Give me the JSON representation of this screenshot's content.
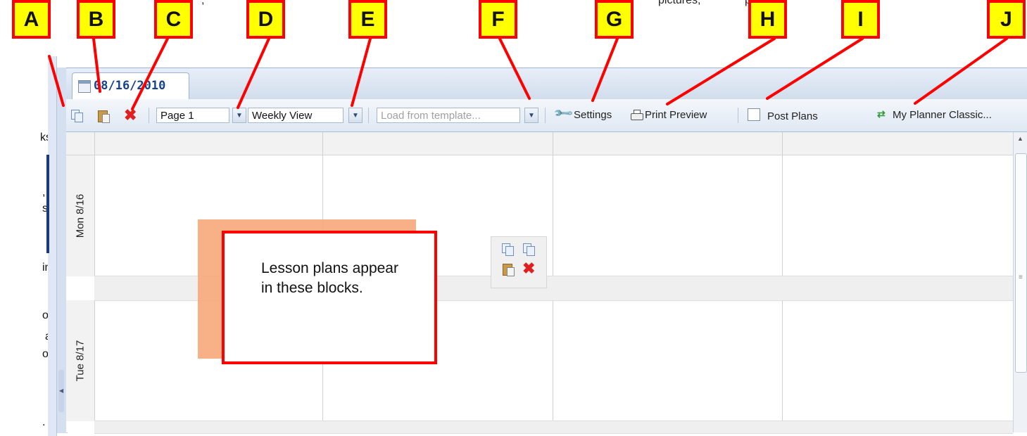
{
  "text_fragments": {
    "top_line": [
      ",",
      "pictures,",
      "page"
    ],
    "left_margin": [
      "ks)",
      ",",
      "s,",
      "in",
      "or",
      "a",
      "or",
      "."
    ]
  },
  "tab": {
    "date": "08/16/2010"
  },
  "toolbar": {
    "page_value": "Page 1",
    "view_value": "Weekly View",
    "template_placeholder": "Load from template...",
    "settings_label": "Settings",
    "print_preview_label": "Print Preview",
    "post_plans_label": "Post Plans",
    "classic_label": "My Planner Classic..."
  },
  "days": [
    "Mon 8/16",
    "Tue 8/17"
  ],
  "callout_text": "Lesson plans appear in these blocks.",
  "markers": [
    "A",
    "B",
    "C",
    "D",
    "E",
    "F",
    "G",
    "H",
    "I",
    "J"
  ],
  "colors": {
    "marker_fill": "#ffff00",
    "marker_border": "#ff0000",
    "arrow": "#ff0000",
    "tab_text": "#15428b",
    "orange_block": "#f7a879"
  },
  "icons": [
    "copy-icon",
    "paste-icon",
    "delete-icon",
    "dropdown-arrow-icon",
    "wrench-icon",
    "printer-icon",
    "checkbox",
    "switch-view-icon",
    "calendar-icon"
  ]
}
